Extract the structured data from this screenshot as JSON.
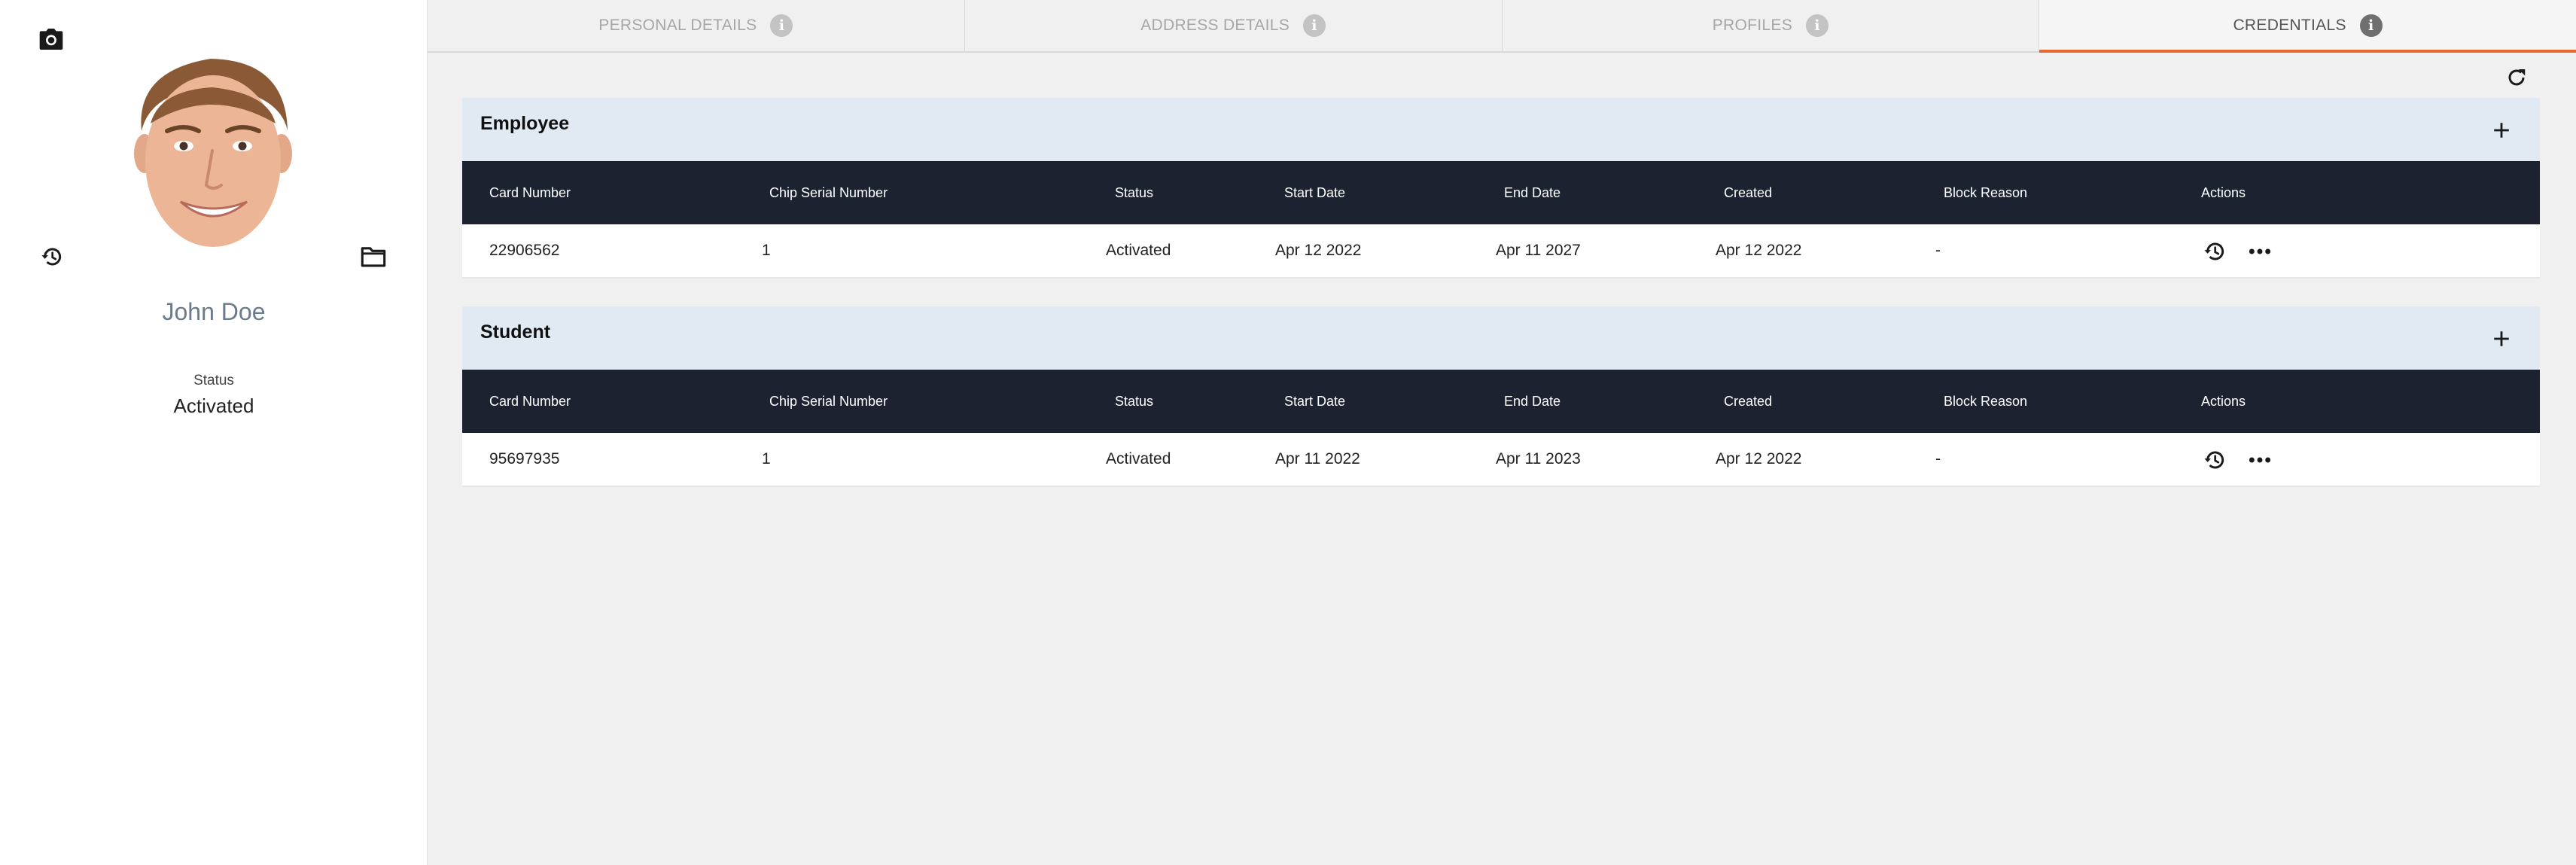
{
  "person": {
    "name": "John Doe",
    "status_label": "Status",
    "status_value": "Activated"
  },
  "tabs": [
    {
      "label": "PERSONAL DETAILS",
      "icon": "info-icon"
    },
    {
      "label": "ADDRESS DETAILS",
      "icon": "info-icon"
    },
    {
      "label": "PROFILES",
      "icon": "info-icon"
    },
    {
      "label": "CREDENTIALS",
      "icon": "info-icon",
      "active": true
    }
  ],
  "table_columns": [
    "Card Number",
    "Chip Serial Number",
    "Status",
    "Start Date",
    "End Date",
    "Created",
    "Block Reason",
    "Actions"
  ],
  "sections": [
    {
      "title": "Employee",
      "rows": [
        {
          "card_number": "22906562",
          "chip_serial": "1",
          "status": "Activated",
          "start_date": "Apr 12 2022",
          "end_date": "Apr 11 2027",
          "created": "Apr 12 2022",
          "block_reason": "-"
        }
      ]
    },
    {
      "title": "Student",
      "rows": [
        {
          "card_number": "95697935",
          "chip_serial": "1",
          "status": "Activated",
          "start_date": "Apr 11 2022",
          "end_date": "Apr 11 2023",
          "created": "Apr 12 2022",
          "block_reason": "-"
        }
      ]
    }
  ],
  "colors": {
    "accent": "#e8692f",
    "table_header": "#1c2230",
    "section_header": "#e1e9f2"
  }
}
